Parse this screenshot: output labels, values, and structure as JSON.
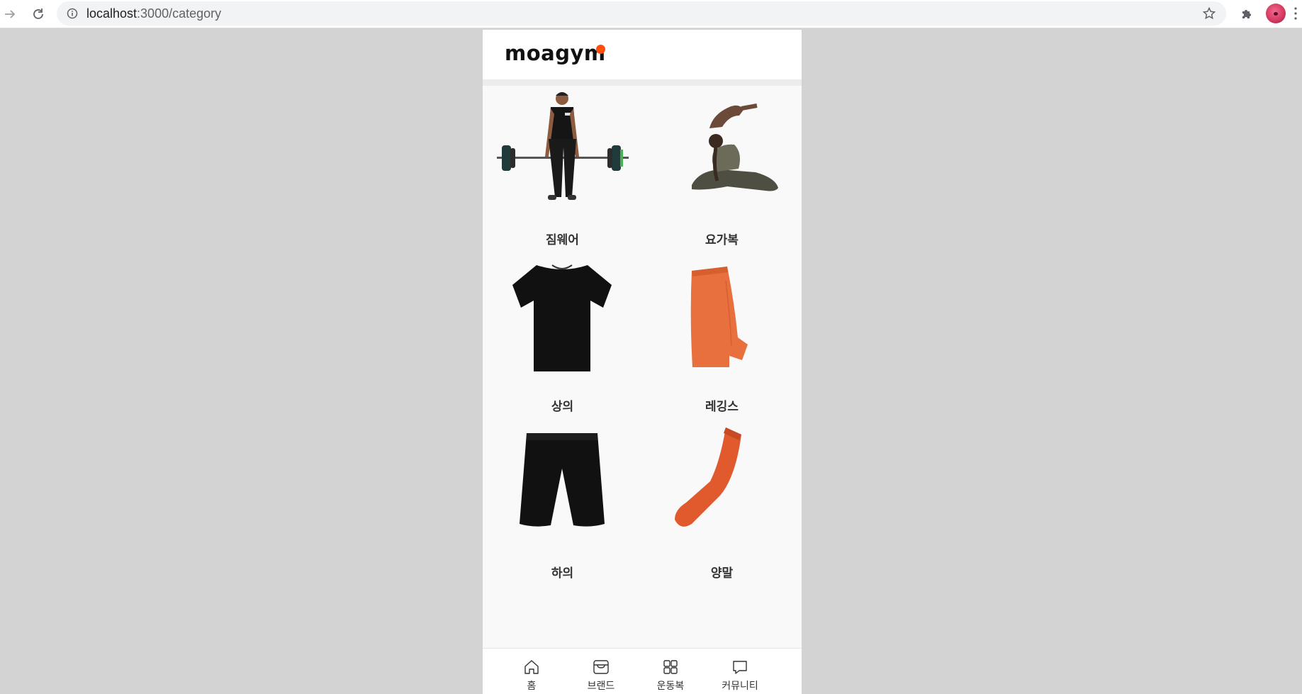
{
  "browser": {
    "url_host": "localhost",
    "url_path": ":3000/category",
    "icons": [
      "back-arrow-icon",
      "reload-icon",
      "site-info-icon",
      "bookmark-star-icon",
      "extensions-puzzle-icon",
      "profile-avatar",
      "more-menu-icon"
    ]
  },
  "app": {
    "logo_text": "moagym",
    "accent_color": "#ff4f0f"
  },
  "categories": [
    {
      "label": "짐웨어",
      "image": "man-deadlift-barbell"
    },
    {
      "label": "요가복",
      "image": "woman-yoga-pose"
    },
    {
      "label": "상의",
      "image": "black-tshirt"
    },
    {
      "label": "레깅스",
      "image": "orange-leggings"
    },
    {
      "label": "하의",
      "image": "black-shorts"
    },
    {
      "label": "양말",
      "image": "orange-sock"
    }
  ],
  "tabbar": {
    "items": [
      {
        "label": "홈",
        "icon": "home-icon"
      },
      {
        "label": "브랜드",
        "icon": "store-icon"
      },
      {
        "label": "운동복",
        "icon": "grid-icon"
      },
      {
        "label": "커뮤니티",
        "icon": "chat-bubble-icon"
      }
    ]
  }
}
